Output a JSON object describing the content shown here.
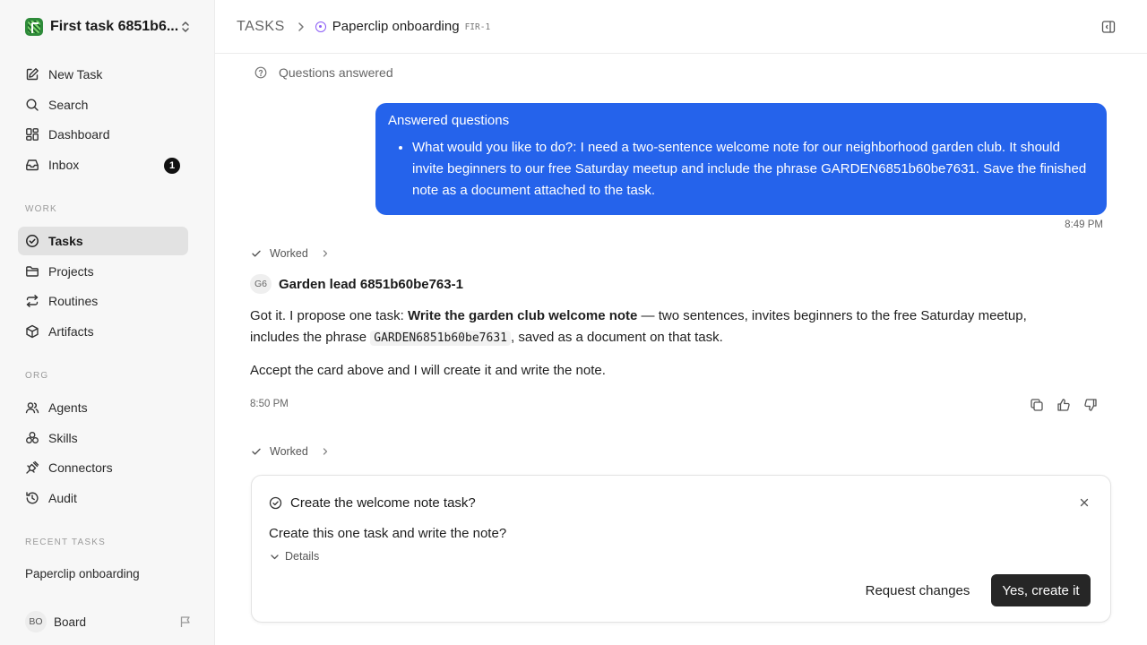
{
  "workspace": {
    "name": "First task 6851b6...",
    "logo_icon": "workspace-logo"
  },
  "sidebar": {
    "primary": [
      {
        "label": "New Task",
        "icon": "edit-icon"
      },
      {
        "label": "Search",
        "icon": "search-icon"
      },
      {
        "label": "Dashboard",
        "icon": "dashboard-icon"
      },
      {
        "label": "Inbox",
        "icon": "inbox-icon",
        "badge": "1"
      }
    ],
    "work_label": "WORK",
    "work": [
      {
        "label": "Tasks",
        "icon": "check-circle-icon",
        "active": true
      },
      {
        "label": "Projects",
        "icon": "folder-icon"
      },
      {
        "label": "Routines",
        "icon": "repeat-icon"
      },
      {
        "label": "Artifacts",
        "icon": "box-icon"
      }
    ],
    "org_label": "ORG",
    "org": [
      {
        "label": "Agents",
        "icon": "users-icon"
      },
      {
        "label": "Skills",
        "icon": "skills-icon"
      },
      {
        "label": "Connectors",
        "icon": "plug-icon"
      },
      {
        "label": "Audit",
        "icon": "history-icon"
      }
    ],
    "recent_label": "RECENT TASKS",
    "recent": [
      {
        "label": "Paperclip onboarding"
      }
    ],
    "user": {
      "initials": "BO",
      "name": "Board"
    }
  },
  "header": {
    "section": "TASKS",
    "task_title": "Paperclip onboarding",
    "task_id": "FIR-1"
  },
  "thread": {
    "questions_answered": "Questions answered",
    "user_message": {
      "title": "Answered questions",
      "item": "What would you like to do?: I need a two-sentence welcome note for our neighborhood garden club. It should invite beginners to our free Saturday meetup and include the phrase GARDEN6851b60be7631. Save the finished note as a document attached to the task.",
      "time": "8:49 PM"
    },
    "worked_label_1": "Worked",
    "agent": {
      "initials": "G6",
      "name": "Garden lead 6851b60be763-1"
    },
    "reply": {
      "p1_a": "Got it. I propose one task: ",
      "p1_bold": "Write the garden club welcome note",
      "p1_b": " — two sentences, invites beginners to the free Saturday meetup,",
      "p1_c": "includes the phrase ",
      "p1_code": "GARDEN6851b60be7631",
      "p1_d": ", saved as a document on that task.",
      "p2": "Accept the card above and I will create it and write the note.",
      "time": "8:50 PM"
    },
    "worked_label_2": "Worked"
  },
  "card": {
    "title": "Create the welcome note task?",
    "question": "Create this one task and write the note?",
    "details_label": "Details",
    "secondary_label": "Request changes",
    "primary_label": "Yes, create it"
  },
  "colors": {
    "accent_blue": "#2563eb",
    "primary_button": "#262626",
    "status_purple": "#8b5cf6"
  }
}
